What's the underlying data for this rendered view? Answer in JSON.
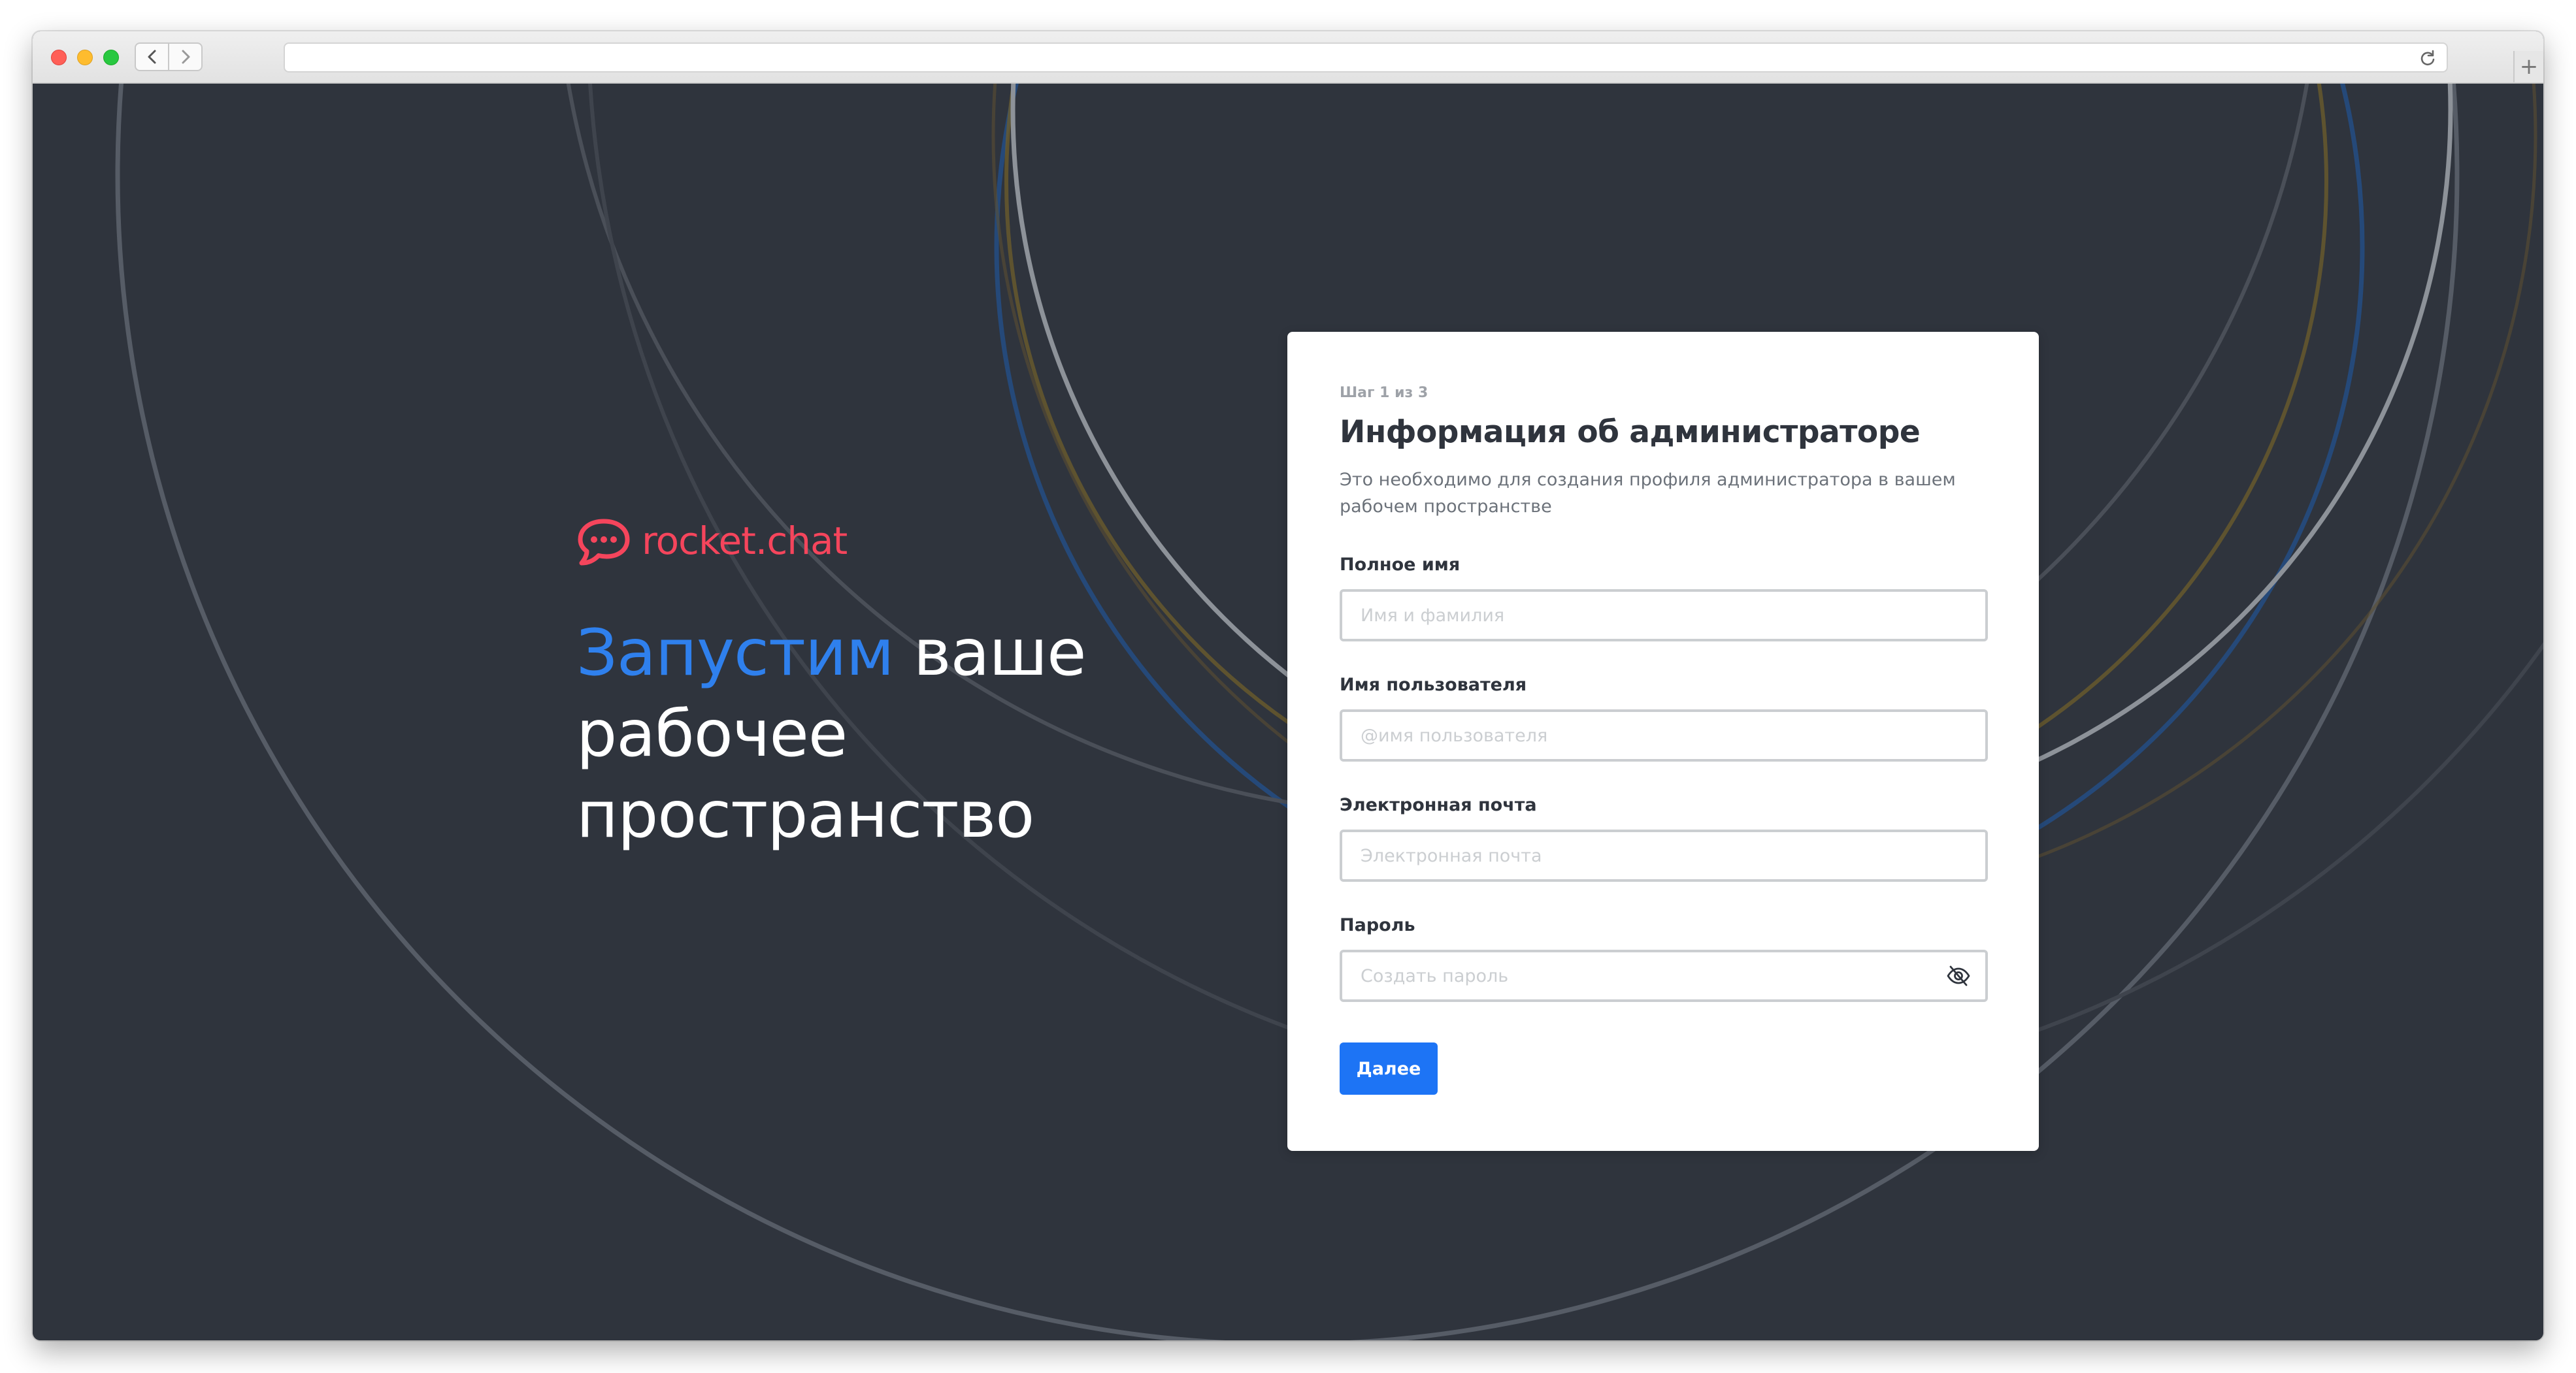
{
  "browser": {
    "new_tab": "+"
  },
  "brand": {
    "name": "rocket.chat",
    "color": "#f5455c"
  },
  "hero": {
    "accent_word": "Запустим",
    "rest": " ваше рабочее пространство",
    "accent_color": "#2f80ed"
  },
  "form": {
    "step": "Шаг 1 из 3",
    "title": "Информация об администраторе",
    "description": "Это необходимо для создания профиля администратора в вашем рабочем пространстве",
    "fields": [
      {
        "label": "Полное имя",
        "value": "",
        "placeholder": "Имя и фамилия"
      },
      {
        "label": "Имя пользователя",
        "value": "",
        "placeholder": "@имя пользователя"
      },
      {
        "label": "Электронная почта",
        "value": "",
        "placeholder": "Электронная почта"
      },
      {
        "label": "Пароль",
        "value": "",
        "placeholder": "Создать пароль",
        "icon": "eye-off-icon"
      }
    ],
    "submit_label": "Далее",
    "submit_color": "#1d74f5"
  },
  "colors": {
    "background": "#2f343d",
    "card": "#ffffff"
  }
}
